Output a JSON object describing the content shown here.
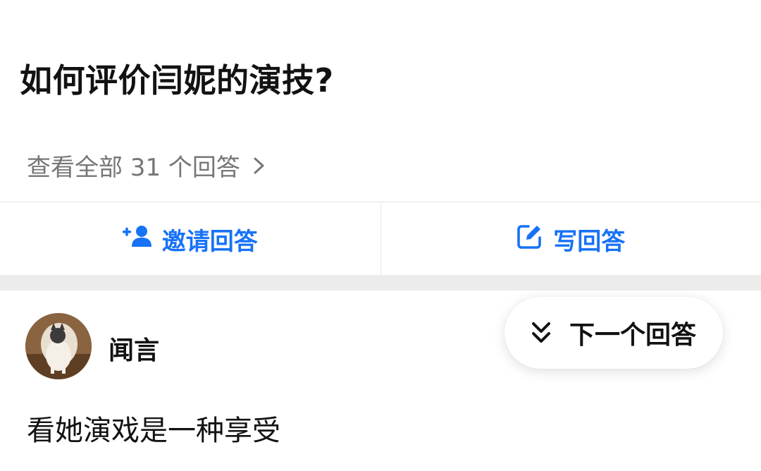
{
  "question": {
    "title": "如何评价闫妮的演技?"
  },
  "view_all": {
    "label": "查看全部 31 个回答",
    "chevron_icon": "chevron-right-icon"
  },
  "actions": {
    "invite": {
      "label": "邀请回答",
      "icon": "add-user-icon"
    },
    "write": {
      "label": "写回答",
      "icon": "edit-icon"
    }
  },
  "answer": {
    "author": {
      "name": "闻言",
      "avatar_icon": "avatar"
    },
    "text": "看她演戏是一种享受"
  },
  "next_answer": {
    "label": "下一个回答",
    "icon": "double-chevron-down-icon"
  },
  "colors": {
    "accent": "#1772f6",
    "text_primary": "#121212",
    "text_secondary": "#767676",
    "divider": "#e6e6e6",
    "band": "#ececec"
  }
}
